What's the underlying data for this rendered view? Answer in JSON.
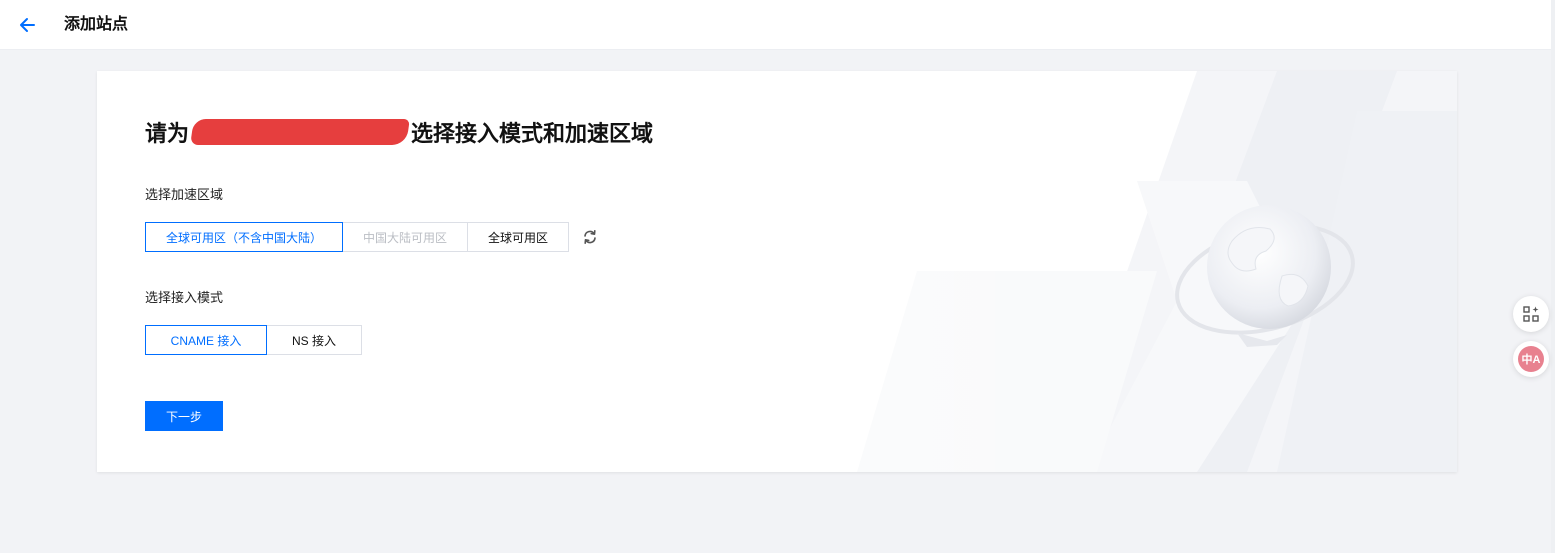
{
  "header": {
    "title": "添加站点",
    "back_icon": "arrow-left-icon"
  },
  "card": {
    "title_prefix": "请为",
    "title_suffix": "选择接入模式和加速区域"
  },
  "region": {
    "label": "选择加速区域",
    "options": [
      {
        "label": "全球可用区（不含中国大陆）",
        "state": "selected"
      },
      {
        "label": "中国大陆可用区",
        "state": "disabled"
      },
      {
        "label": "全球可用区",
        "state": "normal"
      }
    ],
    "refresh_icon": "refresh-icon"
  },
  "mode": {
    "label": "选择接入模式",
    "options": [
      {
        "label": "CNAME 接入",
        "state": "selected"
      },
      {
        "label": "NS 接入",
        "state": "normal"
      }
    ]
  },
  "actions": {
    "next_label": "下一步"
  },
  "floating": {
    "grid_icon": "apps-sparkle-icon",
    "translate_label": "中A"
  },
  "colors": {
    "primary": "#006eff",
    "redaction": "#e63e3e",
    "background": "#f2f3f6",
    "translate_badge": "#e8818f"
  }
}
